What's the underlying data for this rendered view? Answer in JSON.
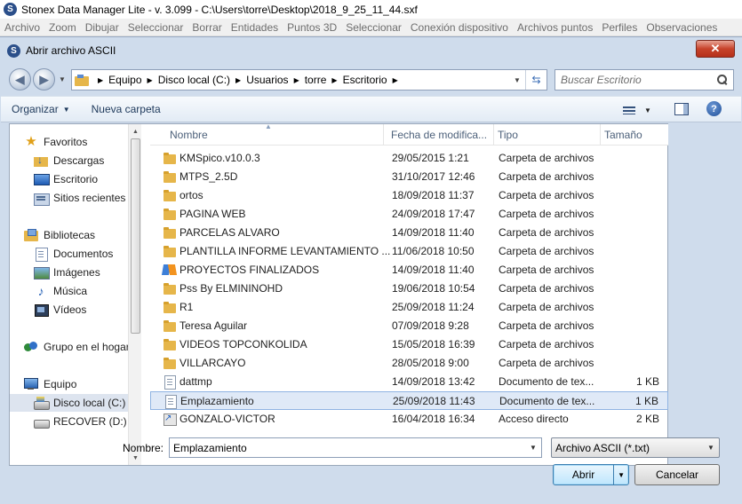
{
  "app": {
    "title": "Stonex Data Manager Lite - v. 3.099 - C:\\Users\\torre\\Desktop\\2018_9_25_11_44.sxf",
    "logo": "S",
    "menu": [
      "Archivo",
      "Zoom",
      "Dibujar",
      "Seleccionar",
      "Borrar",
      "Entidades",
      "Puntos 3D",
      "Seleccionar",
      "Conexión dispositivo",
      "Archivos puntos",
      "Perfiles",
      "Observaciones"
    ]
  },
  "dialog": {
    "title": "Abrir archivo ASCII",
    "close_label": "✕",
    "breadcrumb": [
      "Equipo",
      "Disco local (C:)",
      "Usuarios",
      "torre",
      "Escritorio"
    ],
    "search_placeholder": "Buscar Escritorio",
    "toolbar": {
      "organize_label": "Organizar",
      "new_folder_label": "Nueva carpeta"
    },
    "nav_pane": {
      "favorites_label": "Favoritos",
      "favorites": [
        "Descargas",
        "Escritorio",
        "Sitios recientes"
      ],
      "libraries_label": "Bibliotecas",
      "libraries": [
        "Documentos",
        "Imágenes",
        "Música",
        "Vídeos"
      ],
      "homegroup_label": "Grupo en el hogar",
      "computer_label": "Equipo",
      "drives": [
        "Disco local (C:)",
        "RECOVER (D:)"
      ],
      "selected_drive": "Disco local (C:)"
    },
    "columns": [
      "Nombre",
      "Fecha de modifica...",
      "Tipo",
      "Tamaño"
    ],
    "files": [
      {
        "name": "KMSpico.v10.0.3",
        "date": "29/05/2015 1:21",
        "type": "Carpeta de archivos",
        "size": "",
        "icon": "folder-icon"
      },
      {
        "name": "MTPS_2.5D",
        "date": "31/10/2017 12:46",
        "type": "Carpeta de archivos",
        "size": "",
        "icon": "folder-icon"
      },
      {
        "name": "ortos",
        "date": "18/09/2018 11:37",
        "type": "Carpeta de archivos",
        "size": "",
        "icon": "folder-icon"
      },
      {
        "name": "PAGINA WEB",
        "date": "24/09/2018 17:47",
        "type": "Carpeta de archivos",
        "size": "",
        "icon": "folder-icon"
      },
      {
        "name": "PARCELAS ALVARO",
        "date": "14/09/2018 11:40",
        "type": "Carpeta de archivos",
        "size": "",
        "icon": "folder-icon"
      },
      {
        "name": "PLANTILLA INFORME LEVANTAMIENTO ...",
        "date": "11/06/2018 10:50",
        "type": "Carpeta de archivos",
        "size": "",
        "icon": "folder-icon"
      },
      {
        "name": "PROYECTOS FINALIZADOS",
        "date": "14/09/2018 11:40",
        "type": "Carpeta de archivos",
        "size": "",
        "icon": "special-folder-icon"
      },
      {
        "name": "Pss By ELMININOHD",
        "date": "19/06/2018 10:54",
        "type": "Carpeta de archivos",
        "size": "",
        "icon": "folder-icon"
      },
      {
        "name": "R1",
        "date": "25/09/2018 11:24",
        "type": "Carpeta de archivos",
        "size": "",
        "icon": "folder-icon"
      },
      {
        "name": "Teresa Aguilar",
        "date": "07/09/2018 9:28",
        "type": "Carpeta de archivos",
        "size": "",
        "icon": "folder-icon"
      },
      {
        "name": "VIDEOS TOPCONKOLIDA",
        "date": "15/05/2018 16:39",
        "type": "Carpeta de archivos",
        "size": "",
        "icon": "folder-icon"
      },
      {
        "name": "VILLARCAYO",
        "date": "28/05/2018 9:00",
        "type": "Carpeta de archivos",
        "size": "",
        "icon": "folder-icon"
      },
      {
        "name": "dattmp",
        "date": "14/09/2018 13:42",
        "type": "Documento de tex...",
        "size": "1 KB",
        "icon": "text-file-icon"
      },
      {
        "name": "Emplazamiento",
        "date": "25/09/2018 11:43",
        "type": "Documento de tex...",
        "size": "1 KB",
        "icon": "text-file-icon",
        "selected": true
      },
      {
        "name": "GONZALO-VICTOR",
        "date": "16/04/2018 16:34",
        "type": "Acceso directo",
        "size": "2 KB",
        "icon": "shortcut-icon"
      }
    ],
    "file_name_label": "Nombre:",
    "file_name_value": "Emplazamiento",
    "file_type_value": "Archivo ASCII (*.txt)",
    "open_label": "Abrir",
    "cancel_label": "Cancelar"
  }
}
